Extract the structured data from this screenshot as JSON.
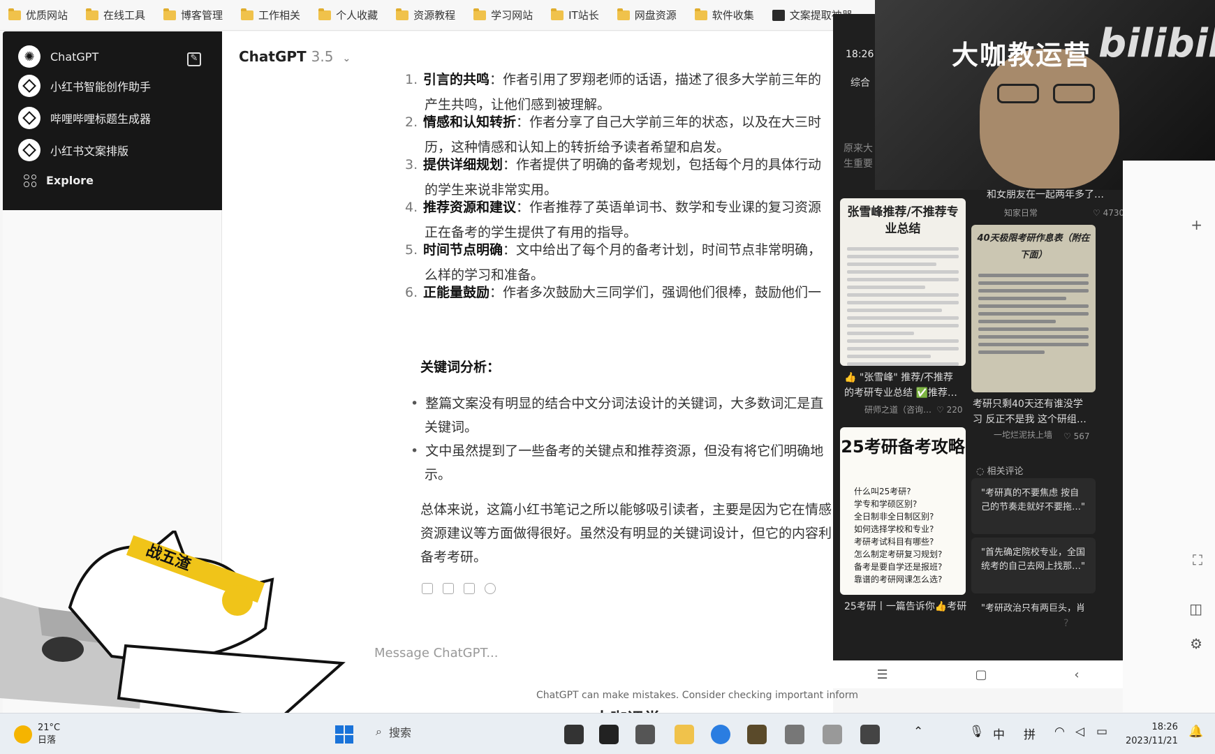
{
  "bookmarks": [
    {
      "label": "优质网站",
      "icon": "folder-icon"
    },
    {
      "label": "在线工具",
      "icon": "folder-icon"
    },
    {
      "label": "博客管理",
      "icon": "folder-icon"
    },
    {
      "label": "工作相关",
      "icon": "folder-icon"
    },
    {
      "label": "个人收藏",
      "icon": "folder-icon"
    },
    {
      "label": "资源教程",
      "icon": "folder-icon"
    },
    {
      "label": "学习网站",
      "icon": "folder-icon"
    },
    {
      "label": "IT站长",
      "icon": "folder-icon"
    },
    {
      "label": "网盘资源",
      "icon": "folder-icon"
    },
    {
      "label": "软件收集",
      "icon": "folder-icon"
    },
    {
      "label": "文案提取神器",
      "icon": "app-icon"
    }
  ],
  "sidebar": {
    "items": [
      {
        "label": "ChatGPT"
      },
      {
        "label": "小红书智能创作助手"
      },
      {
        "label": "哔哩哔哩标题生成器"
      },
      {
        "label": "小红书文案排版"
      },
      {
        "label": "Explore"
      }
    ]
  },
  "main": {
    "model_name": "ChatGPT",
    "model_version": "3.5",
    "list": [
      {
        "num": "1.",
        "title": "引言的共鸣",
        "line1": "：作者引用了罗翔老师的话语，描述了很多大学前三年的",
        "line2": "产生共鸣，让他们感到被理解。"
      },
      {
        "num": "2.",
        "title": "情感和认知转折",
        "line1": "：作者分享了自己大学前三年的状态，以及在大三时",
        "line2": "历，这种情感和认知上的转折给予读者希望和启发。"
      },
      {
        "num": "3.",
        "title": "提供详细规划",
        "line1": "：作者提供了明确的备考规划，包括每个月的具体行动",
        "line2": "的学生来说非常实用。"
      },
      {
        "num": "4.",
        "title": "推荐资源和建议",
        "line1": "：作者推荐了英语单词书、数学和专业课的复习资源",
        "line2": "正在备考的学生提供了有用的指导。"
      },
      {
        "num": "5.",
        "title": "时间节点明确",
        "line1": "：文中给出了每个月的备考计划，时间节点非常明确，",
        "line2": "么样的学习和准备。"
      },
      {
        "num": "6.",
        "title": "正能量鼓励",
        "line1": "：作者多次鼓励大三同学们，强调他们很棒，鼓励他们一",
        "line2": ""
      }
    ],
    "keyword_title": "关键词分析：",
    "bullets": [
      {
        "line1": "整篇文案没有明显的结合中文分词法设计的关键词，大多数词汇是直",
        "line2": "关键词。"
      },
      {
        "line1": "文中虽然提到了一些备考的关键点和推荐资源，但没有将它们明确地",
        "line2": "示。"
      }
    ],
    "summary": [
      "总体来说，这篇小红书笔记之所以能够吸引读者，主要是因为它在情感",
      "资源建议等方面做得很好。虽然没有明显的关键词设计，但它的内容利",
      "备考考研。"
    ],
    "composer_placeholder": "Message ChatGPT...",
    "disclaimer": "ChatGPT can make mistakes. Consider checking important inform"
  },
  "phone": {
    "time": "18:26",
    "tab": "综合",
    "partial_text_1": "原来大",
    "partial_text_2": "生重要",
    "card1_caption": "和女朋友在一起两年多了…",
    "card1_author": "知家日常",
    "card1_likes": "4730",
    "card2_title": "张雪峰推荐/不推荐专业总结",
    "card2_caption_1": "👍 \"张雪峰\" 推荐/不推荐",
    "card2_caption_2": "的考研专业总结 ✅推荐…",
    "card2_author": "研师之道（咨询…",
    "card2_likes": "220",
    "card3_title": "40天极限考研作息表（附在下面）",
    "card3_caption_1": "考研只剩40天还有谁没学",
    "card3_caption_2": "习 反正不是我 这个研组…",
    "card3_author": "一坨烂泥扶上墙",
    "card3_likes": "567",
    "card4_title": "25考研备考攻略",
    "card4_items": [
      "什么叫25考研?",
      "学专和学硕区别?",
      "全日制非全日制区别?",
      "如何选择学校和专业?",
      "考研考试科目有哪些?",
      "怎么制定考研复习规划?",
      "备考是要自学还是报班?",
      "靠谱的考研网课怎么选?"
    ],
    "card4_caption": "25考研丨一篇告诉你👍考研",
    "related_label": "相关评论",
    "comments": [
      {
        "line1": "\"考研真的不要焦虑 按自",
        "line2": "己的节奏走就好不要拖…\""
      },
      {
        "line1": "\"首先确定院校专业，全国",
        "line2": "统考的自己去网上找那…\""
      },
      {
        "line1": "\"考研政治只有两巨头，肖",
        "line2": ""
      }
    ]
  },
  "webcam": {
    "channel": "大咖教运营",
    "logo": "bilibili"
  },
  "watermark": "大咖课堂",
  "taskbar": {
    "temperature": "21°C",
    "weather": "日落",
    "search": "搜索",
    "ime1": "中",
    "ime2": "拼",
    "time": "18:26",
    "date": "2023/11/21"
  },
  "colors": {
    "sidebar_bg": "#171717",
    "accent_blue": "#1a73d9",
    "phone_bg": "#1f1f1f"
  }
}
